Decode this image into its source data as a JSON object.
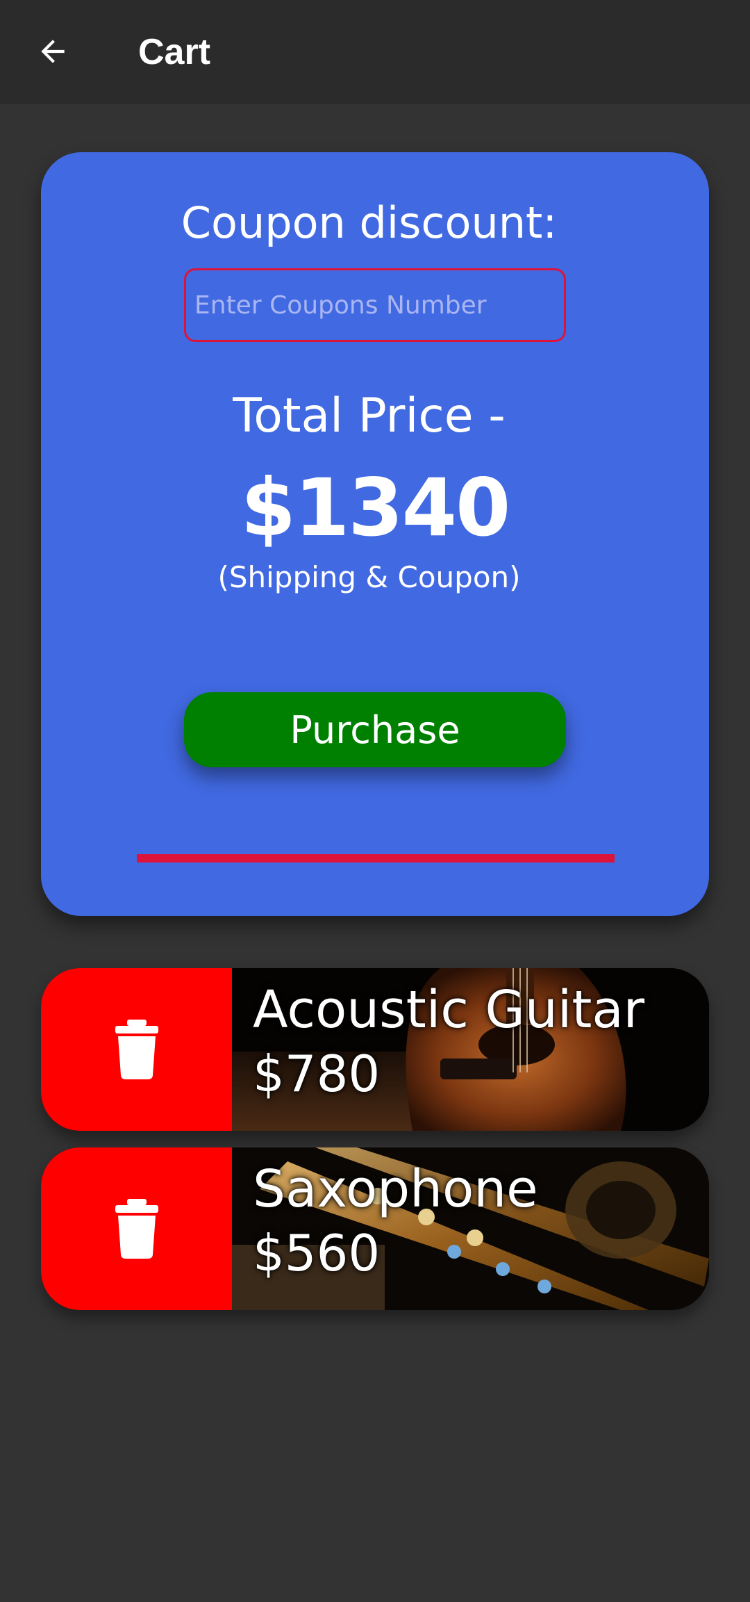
{
  "colors": {
    "background": "#333333",
    "app_bar": "#2b2b2b",
    "card": "#4169e1",
    "accent_red": "#dc143c",
    "purchase_button": "#008000",
    "delete": "#ff0000"
  },
  "app_bar": {
    "back_icon": "arrow-left-icon",
    "title": "Cart"
  },
  "summary": {
    "coupon_label": "Coupon discount:",
    "coupon_input": {
      "placeholder": "Enter Coupons Number",
      "value": ""
    },
    "total_label": "Total Price -",
    "total_value": "$1340",
    "total_note": "(Shipping & Coupon)",
    "purchase_label": "Purchase"
  },
  "cart_items": [
    {
      "name": "Acoustic Guitar",
      "price": "$780",
      "delete_icon": "trash-icon"
    },
    {
      "name": "Saxophone",
      "price": "$560",
      "delete_icon": "trash-icon"
    }
  ]
}
